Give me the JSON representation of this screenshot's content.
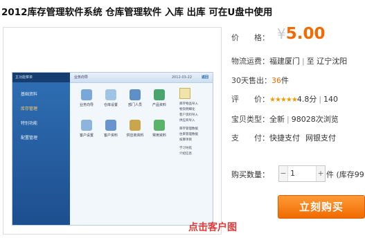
{
  "product": {
    "title": "2012库存管理软件系统 仓库管理软件 入库 出库 可在U盘中使用"
  },
  "image": {
    "app_sidebar_header": "主功能菜单",
    "app_sidebar_items": [
      "基础资料",
      "库存管理",
      "特别功能",
      "配置管理"
    ],
    "app_topbar": "业务向导",
    "app_date": "2012-03-22",
    "app_back": "返回",
    "app_icons": [
      "业务向导",
      "仓库设置",
      "部门人员",
      "产品资料",
      "客户设置",
      "客户资料",
      "供应商资料",
      "常用资料"
    ],
    "app_side_links": [
      "库存物品导入",
      "物资明细化",
      "客户资料导入",
      "供应商导入",
      "库存管理数据",
      "往来管理数据",
      "核算项目",
      "学习导航",
      "介绍信息"
    ],
    "bottom_partial_text": "点击客户图"
  },
  "info": {
    "price_label": "价　　格：",
    "price_currency": "¥",
    "price_value": "5.00",
    "shipping_label": "物流运费：",
    "shipping_from": "福建厦门",
    "shipping_to": "辽宁沈阳",
    "sold_label": "30天售出：",
    "sold_count": "36",
    "sold_unit": "件",
    "rating_label": "评　　价：",
    "rating_stars": "★★★★★",
    "rating_score": "4.8分",
    "rating_count": "140",
    "type_label": "宝贝类型：",
    "type_value": "全新",
    "views": "98028次浏览",
    "pay_label": "支　　付：",
    "pay_1": "快捷支付",
    "pay_2": "网银支付"
  },
  "purchase": {
    "qty_label": "购买数量：",
    "qty_value": "1",
    "qty_unit": "件 (库存99",
    "buy_label": "立刻购买"
  }
}
